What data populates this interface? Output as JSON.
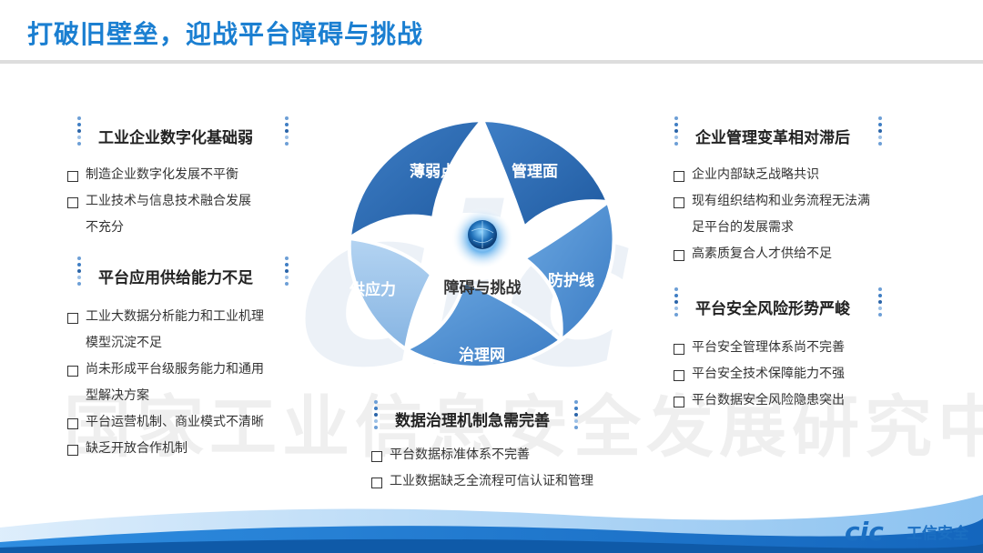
{
  "title": "打破旧壁垒，迎战平台障碍与挑战",
  "watermark": "国家工业信息安全发展研究中心",
  "center": {
    "label": "障碍与挑战",
    "segments": [
      "薄弱点",
      "管理面",
      "防护线",
      "治理网",
      "供应力"
    ]
  },
  "sections": {
    "left_top": {
      "title": "工业企业数字化基础弱",
      "items": [
        "制造企业数字化发展不平衡",
        "工业技术与信息技术融合发展",
        "不充分"
      ]
    },
    "left_bottom": {
      "title": "平台应用供给能力不足",
      "items": [
        "工业大数据分析能力和工业机理",
        "模型沉淀不足",
        "尚未形成平台级服务能力和通用",
        "型解决方案",
        "平台运营机制、商业模式不清晰",
        "缺乏开放合作机制"
      ]
    },
    "right_top": {
      "title": "企业管理变革相对滞后",
      "items": [
        "企业内部缺乏战略共识",
        "现有组织结构和业务流程无法满",
        "足平台的发展需求",
        "高素质复合人才供给不足"
      ]
    },
    "right_bottom": {
      "title": "平台安全风险形势严峻",
      "items": [
        "平台安全管理体系尚不完善",
        "平台安全技术保障能力不强",
        "平台数据安全风险隐患突出"
      ]
    },
    "bottom_center": {
      "title": "数据治理机制急需完善",
      "items": [
        "平台数据标准体系不完善",
        "工业数据缺乏全流程可信认证和管理"
      ]
    }
  },
  "brand": {
    "logo_text": "cic",
    "name": "工信安全"
  },
  "colors": {
    "title_blue": "#1b7fd1",
    "dark_segment": "#2b69b2",
    "mid_segment": "#4f8fd1",
    "light_segment": "#94bee8"
  }
}
